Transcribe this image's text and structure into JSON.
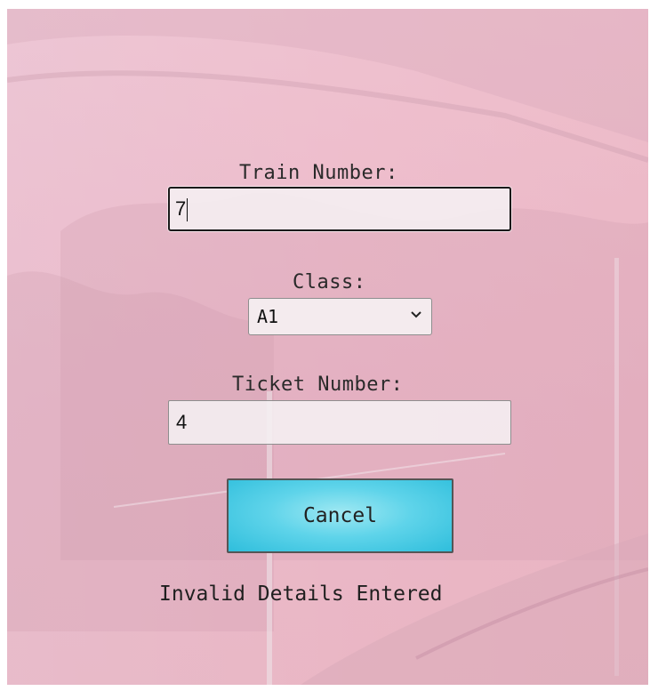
{
  "form": {
    "train_number_label": "Train Number:",
    "train_number_value": "7",
    "class_label": "Class:",
    "class_selected": "A1",
    "ticket_number_label": "Ticket Number:",
    "ticket_number_value": "4",
    "cancel_label": "Cancel",
    "status_message": "Invalid Details Entered"
  },
  "colors": {
    "button_fill": "#5fd4ea",
    "background_tint": "#ebbfcd"
  }
}
